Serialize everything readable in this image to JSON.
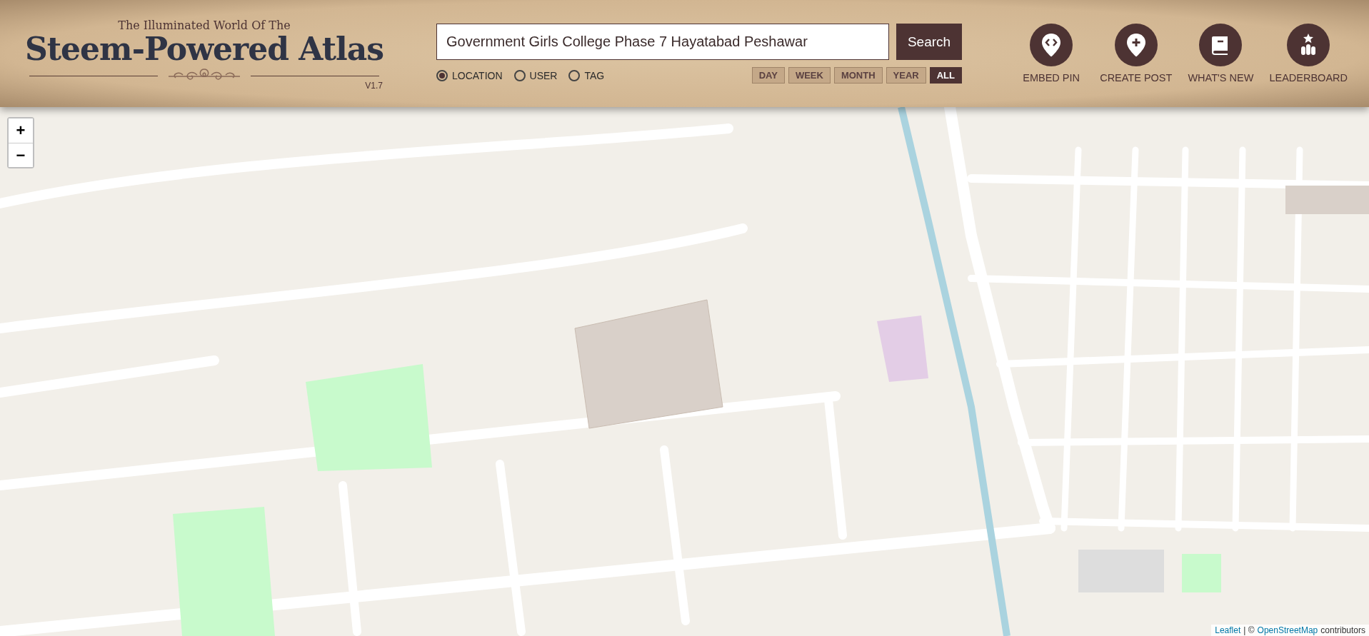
{
  "header": {
    "tagline": "The Illuminated World Of The",
    "title": "Steem-Powered Atlas",
    "version": "V1.7"
  },
  "search": {
    "value": "Government Girls College Phase 7 Hayatabad Peshawar",
    "button": "Search"
  },
  "search_types": [
    {
      "label": "LOCATION",
      "selected": true
    },
    {
      "label": "USER",
      "selected": false
    },
    {
      "label": "TAG",
      "selected": false
    }
  ],
  "periods": [
    {
      "label": "DAY",
      "selected": false
    },
    {
      "label": "WEEK",
      "selected": false
    },
    {
      "label": "MONTH",
      "selected": false
    },
    {
      "label": "YEAR",
      "selected": false
    },
    {
      "label": "ALL",
      "selected": true
    }
  ],
  "actions": [
    {
      "kind": "embed",
      "label": "EMBED PIN"
    },
    {
      "kind": "create",
      "label": "CREATE POST"
    },
    {
      "kind": "news",
      "label": "WHAT'S NEW"
    },
    {
      "kind": "leaderboard",
      "label": "LEADERBOARD"
    }
  ],
  "map": {
    "zoom_in": "+",
    "zoom_out": "−",
    "attribution": {
      "link1": "Leaflet",
      "separator": "| ©",
      "link2": "OpenStreetMap",
      "suffix": "contributors"
    }
  }
}
